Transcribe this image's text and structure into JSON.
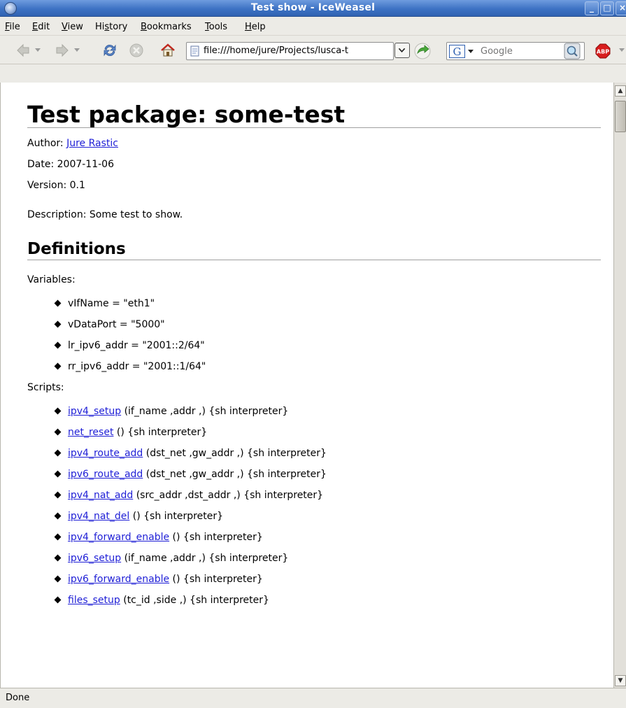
{
  "window": {
    "title": "Test show - IceWeasel",
    "buttons": {
      "minimize": "_",
      "maximize": "□",
      "close": "×"
    }
  },
  "menubar": {
    "items": [
      {
        "label": "File",
        "mnemonic": "F"
      },
      {
        "label": "Edit",
        "mnemonic": "E"
      },
      {
        "label": "View",
        "mnemonic": "V"
      },
      {
        "label": "History",
        "mnemonic": "s"
      },
      {
        "label": "Bookmarks",
        "mnemonic": "B"
      },
      {
        "label": "Tools",
        "mnemonic": "T"
      },
      {
        "label": "Help",
        "mnemonic": "H"
      }
    ]
  },
  "toolbar": {
    "url": "file:///home/jure/Projects/lusca-t",
    "search_placeholder": "Google",
    "icons": [
      "back-icon",
      "forward-icon",
      "reload-icon",
      "stop-icon",
      "home-icon",
      "page-icon",
      "go-icon",
      "google-icon",
      "magnifier-icon",
      "adblock-icon"
    ]
  },
  "page": {
    "heading": "Test package: some-test",
    "author_label": "Author: ",
    "author_name": "Jure Rastic",
    "date": "Date: 2007-11-06",
    "version": "Version: 0.1",
    "description": "Description: Some test to show.",
    "definitions_heading": "Definitions",
    "variables_label": "Variables:",
    "variables": [
      "vIfName = \"eth1\"",
      "vDataPort = \"5000\"",
      "lr_ipv6_addr = \"2001::2/64\"",
      "rr_ipv6_addr = \"2001::1/64\""
    ],
    "scripts_label": "Scripts:",
    "scripts": [
      {
        "name": "ipv4_setup",
        "rest": " (if_name ,addr ,) {sh interpreter}"
      },
      {
        "name": "net_reset",
        "rest": " () {sh interpreter}"
      },
      {
        "name": "ipv4_route_add",
        "rest": " (dst_net ,gw_addr ,) {sh interpreter}"
      },
      {
        "name": "ipv6_route_add",
        "rest": " (dst_net ,gw_addr ,) {sh interpreter}"
      },
      {
        "name": "ipv4_nat_add",
        "rest": " (src_addr ,dst_addr ,) {sh interpreter}"
      },
      {
        "name": "ipv4_nat_del",
        "rest": " () {sh interpreter}"
      },
      {
        "name": "ipv4_forward_enable",
        "rest": " () {sh interpreter}"
      },
      {
        "name": "ipv6_setup",
        "rest": " (if_name ,addr ,) {sh interpreter}"
      },
      {
        "name": "ipv6_forward_enable",
        "rest": " () {sh interpreter}"
      },
      {
        "name": "files_setup",
        "rest": " (tc_id ,side ,) {sh interpreter}"
      }
    ]
  },
  "status": {
    "text": "Done"
  }
}
